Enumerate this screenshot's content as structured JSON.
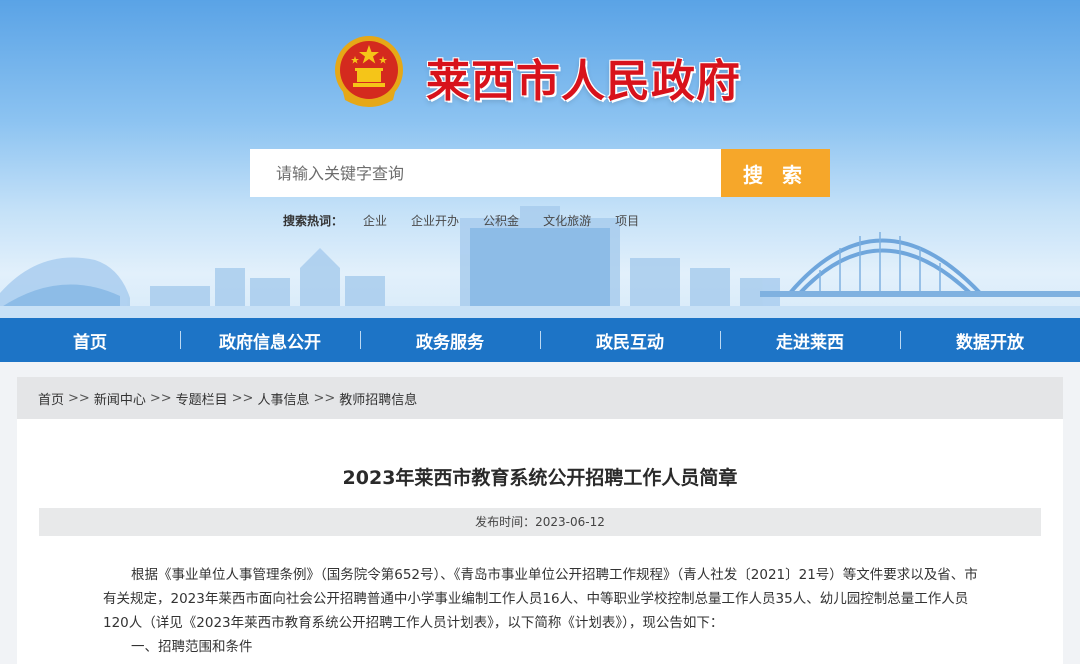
{
  "header": {
    "site_title": "莱西市人民政府"
  },
  "search": {
    "placeholder": "请输入关键字查询",
    "button_label": "搜 索",
    "hot_label": "搜索热词：",
    "hot_terms": [
      "企业",
      "企业开办",
      "公积金",
      "文化旅游",
      "项目"
    ]
  },
  "nav": {
    "items": [
      "首页",
      "政府信息公开",
      "政务服务",
      "政民互动",
      "走进莱西",
      "数据开放"
    ]
  },
  "breadcrumb": {
    "items": [
      "首页",
      "新闻中心",
      "专题栏目",
      "人事信息",
      "教师招聘信息"
    ],
    "separator": ">>"
  },
  "article": {
    "title": "2023年莱西市教育系统公开招聘工作人员简章",
    "publish_time": "发布时间：2023-06-12",
    "paragraph_1": "根据《事业单位人事管理条例》（国务院令第652号）、《青岛市事业单位公开招聘工作规程》（青人社发〔2021〕21号）等文件要求以及省、市有关规定，2023年莱西市面向社会公开招聘普通中小学事业编制工作人员16人、中等职业学校控制总量工作人员35人、幼儿园控制总量工作人员120人（详见《2023年莱西市教育系统公开招聘工作人员计划表》，以下简称《计划表》），现公告如下：",
    "section_1": "一、招聘范围和条件"
  },
  "colors": {
    "title_red": "#d8121b",
    "nav_blue": "#1d74c6",
    "search_orange": "#f6a72a"
  }
}
